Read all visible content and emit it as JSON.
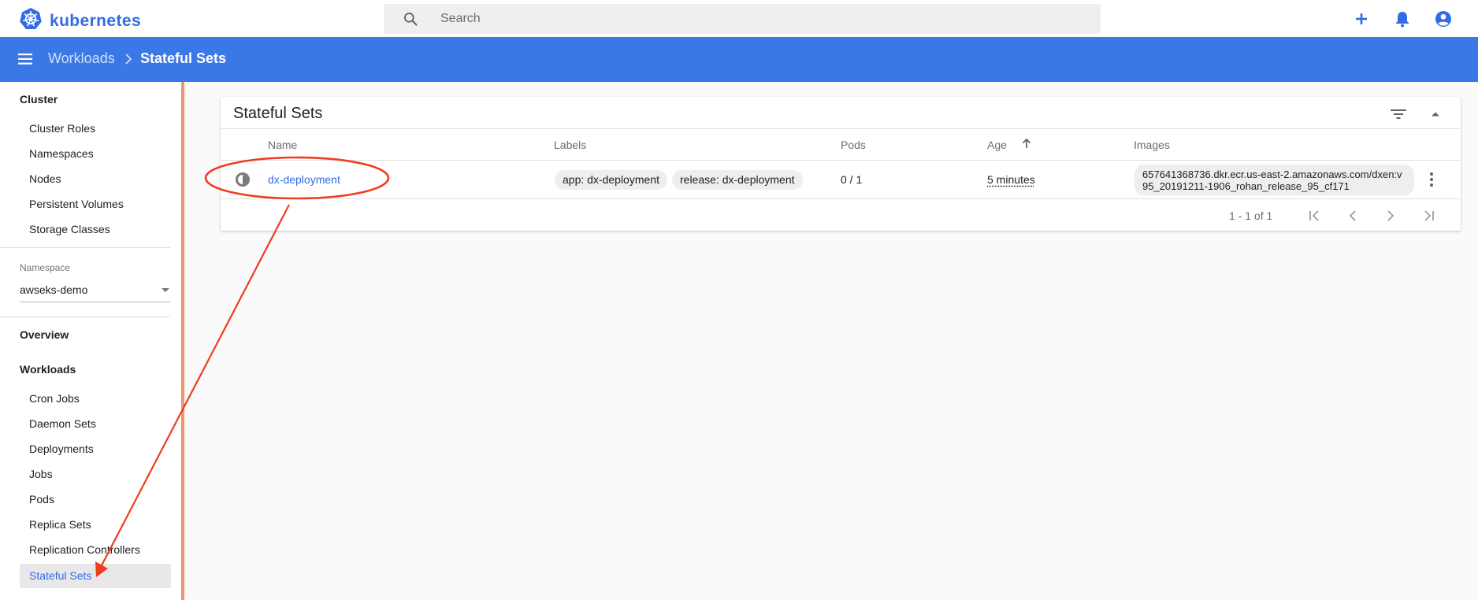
{
  "app": {
    "name": "kubernetes"
  },
  "search": {
    "placeholder": "Search"
  },
  "top_actions": {
    "icons": [
      "add-icon",
      "bell-icon",
      "account-circle-icon"
    ]
  },
  "breadcrumb": {
    "parent": "Workloads",
    "current": "Stateful Sets"
  },
  "sidebar": {
    "cluster_heading": "Cluster",
    "cluster_items": [
      "Cluster Roles",
      "Namespaces",
      "Nodes",
      "Persistent Volumes",
      "Storage Classes"
    ],
    "namespace_label": "Namespace",
    "namespace_value": "awseks-demo",
    "overview": "Overview",
    "workloads_heading": "Workloads",
    "workload_items": [
      "Cron Jobs",
      "Daemon Sets",
      "Deployments",
      "Jobs",
      "Pods",
      "Replica Sets",
      "Replication Controllers",
      "Stateful Sets"
    ],
    "active_item": "Stateful Sets"
  },
  "card": {
    "title": "Stateful Sets",
    "columns": {
      "name": "Name",
      "labels": "Labels",
      "pods": "Pods",
      "age": "Age",
      "images": "Images"
    },
    "rows": [
      {
        "name": "dx-deployment",
        "labels": [
          "app: dx-deployment",
          "release: dx-deployment"
        ],
        "pods": "0 / 1",
        "age": "5 minutes",
        "image": "657641368736.dkr.ecr.us-east-2.amazonaws.com/dxen:v95_20191211-1906_rohan_release_95_cf171"
      }
    ],
    "pagination": {
      "range": "1 - 1 of 1"
    }
  },
  "colors": {
    "brand": "#326ce5",
    "header_bar": "#3b78e7",
    "annotation": "#f03c1e",
    "sidebar_edge": "#f0956b"
  }
}
